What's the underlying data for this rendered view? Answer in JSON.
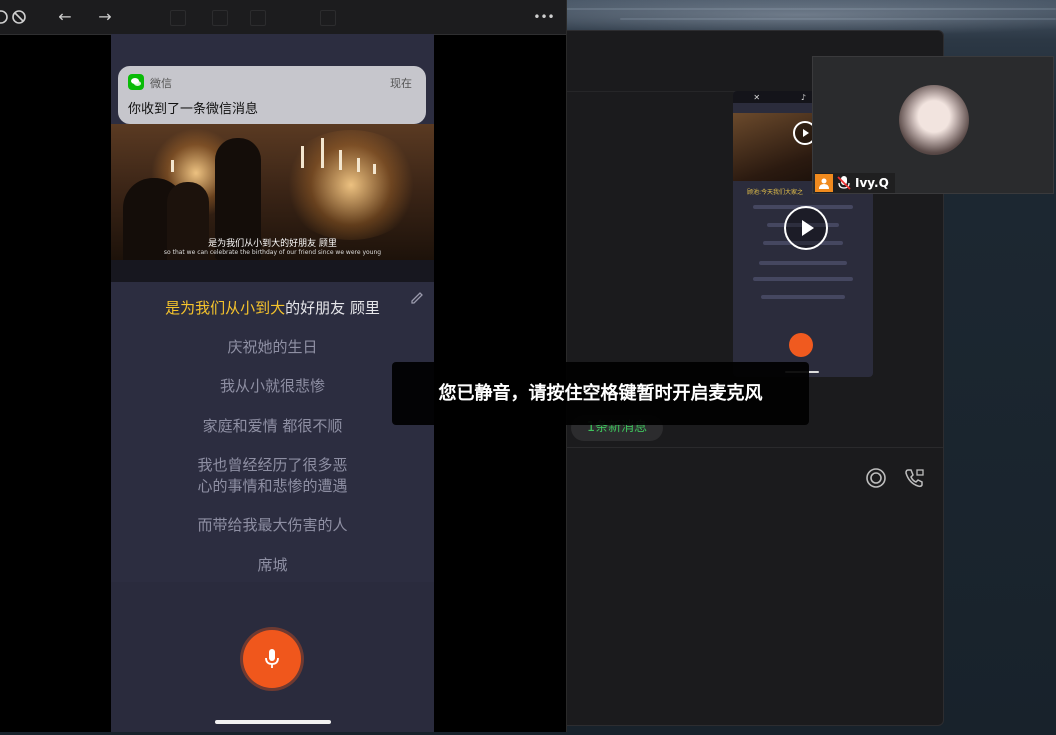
{
  "phone_window": {
    "toolbar": {
      "back": "←",
      "forward": "→",
      "more": "•••"
    },
    "notification": {
      "app": "微信",
      "time": "现在",
      "body": "你收到了一条微信消息"
    },
    "video": {
      "subtitle_cn": "是为我们从小到大的好朋友 顾里",
      "subtitle_en": "so that we can celebrate the birthday of our friend since we were young"
    },
    "lyrics": {
      "current_highlight": "是为我们从小到大",
      "current_rest": "的好朋友 顾里",
      "lines": [
        "庆祝她的生日",
        "我从小就很悲惨",
        "家庭和爱情 都很不顺",
        "我也曾经经历了很多恶",
        "心的事情和悲惨的遭遇",
        "而带给我最大伤害的人",
        "席城"
      ]
    }
  },
  "chat_window": {
    "new_message": "1条新消息",
    "mini_caption": "顾池:今天我们大家之"
  },
  "participant": {
    "name": "Ivy.Q"
  },
  "toast": {
    "text": "您已静音，请按住空格键暂时开启麦克风"
  },
  "colors": {
    "highlight": "#f5c32c",
    "mic": "#f0571c",
    "wechat": "#09bb07",
    "new_message": "#3ec25c",
    "badge": "#f08a1e"
  }
}
